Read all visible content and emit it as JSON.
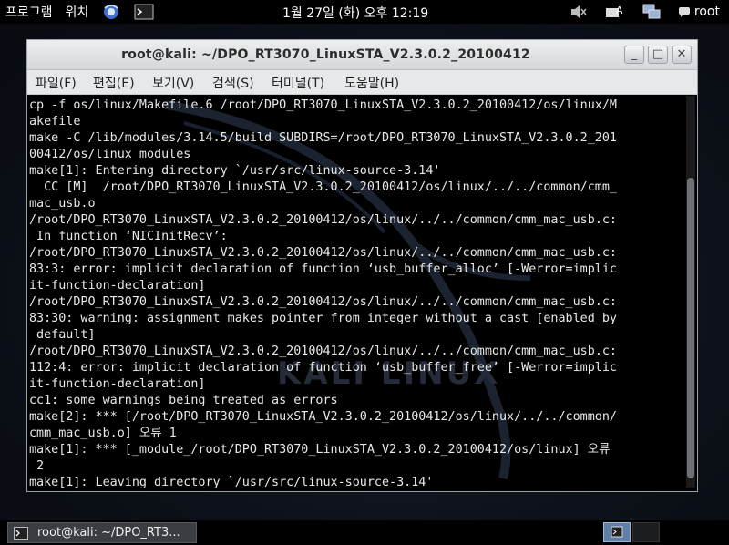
{
  "top_panel": {
    "applications": "프로그램",
    "places": "위치",
    "clock": "1월 27일 (화) 오후 12:19",
    "user": "root",
    "icons": [
      "iceweasel-icon",
      "terminal-icon",
      "volume-muted-icon",
      "keyboard-icon",
      "network-icon",
      "chat-icon"
    ]
  },
  "window": {
    "title": "root@kali: ~/DPO_RT3070_LinuxSTA_V2.3.0.2_20100412",
    "buttons": {
      "minimize": "_",
      "maximize": "□",
      "close": "✕"
    },
    "menu": [
      "파일(F)",
      "편집(E)",
      "보기(V)",
      "검색(S)",
      "터미널(T)",
      "도움말(H)"
    ]
  },
  "terminal": {
    "lines": [
      "cp -f os/linux/Makefile.6 /root/DPO_RT3070_LinuxSTA_V2.3.0.2_20100412/os/linux/M",
      "akefile",
      "make -C /lib/modules/3.14.5/build SUBDIRS=/root/DPO_RT3070_LinuxSTA_V2.3.0.2_201",
      "00412/os/linux modules",
      "make[1]: Entering directory `/usr/src/linux-source-3.14'",
      "  CC [M]  /root/DPO_RT3070_LinuxSTA_V2.3.0.2_20100412/os/linux/../../common/cmm_",
      "mac_usb.o",
      "/root/DPO_RT3070_LinuxSTA_V2.3.0.2_20100412/os/linux/../../common/cmm_mac_usb.c:",
      " In function ‘NICInitRecv’:",
      "/root/DPO_RT3070_LinuxSTA_V2.3.0.2_20100412/os/linux/../../common/cmm_mac_usb.c:",
      "83:3: error: implicit declaration of function ‘usb_buffer_alloc’ [-Werror=implic",
      "it-function-declaration]",
      "/root/DPO_RT3070_LinuxSTA_V2.3.0.2_20100412/os/linux/../../common/cmm_mac_usb.c:",
      "83:30: warning: assignment makes pointer from integer without a cast [enabled by",
      " default]",
      "/root/DPO_RT3070_LinuxSTA_V2.3.0.2_20100412/os/linux/../../common/cmm_mac_usb.c:",
      "112:4: error: implicit declaration of function ‘usb_buffer_free’ [-Werror=implic",
      "it-function-declaration]",
      "cc1: some warnings being treated as errors",
      "make[2]: *** [/root/DPO_RT3070_LinuxSTA_V2.3.0.2_20100412/os/linux/../../common/",
      "cmm_mac_usb.o] 오류 1",
      "make[1]: *** [_module_/root/DPO_RT3070_LinuxSTA_V2.3.0.2_20100412/os/linux] 오류",
      " 2",
      "make[1]: Leaving directory `/usr/src/linux-source-3.14'"
    ],
    "watermark": "KALI LINUX"
  },
  "taskbar": {
    "task_label": "root@kali: ~/DPO_RT3...",
    "workspaces": [
      "1",
      "2"
    ]
  },
  "colors": {
    "panel": "#000000",
    "terminal_bg": "#000000",
    "terminal_fg": "#e8e8e8",
    "error_underline": "#b8a800",
    "workspace_active": "#5e7fa8"
  }
}
